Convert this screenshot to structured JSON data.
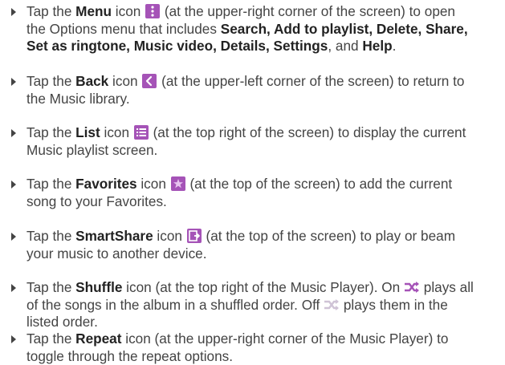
{
  "colors": {
    "accent": "#a553b7",
    "text": "#444444"
  },
  "items": [
    {
      "icon": "menu-icon",
      "l1": {
        "a": "Tap the ",
        "b": "Menu",
        "c": " icon ",
        "d": " (at the upper-right corner of the screen) to open"
      },
      "l2": {
        "a": "the Options menu that includes ",
        "b": "Search, Add to playlist, Delete, Share,"
      },
      "l3": {
        "a": "Set as ringtone, Music video, Details, Settings",
        "b": ", and ",
        "c": "Help",
        "d": "."
      }
    },
    {
      "icon": "back-icon",
      "l1": {
        "a": "Tap the ",
        "b": "Back",
        "c": " icon ",
        "d": " (at the upper-left corner of the screen) to return to"
      },
      "l2": {
        "a": "the Music library."
      }
    },
    {
      "icon": "list-icon",
      "l1": {
        "a": "Tap the ",
        "b": "List",
        "c": " icon ",
        "d": " (at the top right of the screen) to display the current"
      },
      "l2": {
        "a": "Music playlist screen."
      }
    },
    {
      "icon": "favorites-icon",
      "l1": {
        "a": "Tap the ",
        "b": "Favorites",
        "c": " icon ",
        "d": " (at the top of the screen) to add the current"
      },
      "l2": {
        "a": "song to your Favorites."
      }
    },
    {
      "icon": "smartshare-icon",
      "l1": {
        "a": "Tap the ",
        "b": "SmartShare",
        "c": " icon ",
        "d": " (at the top of the screen) to play or beam"
      },
      "l2": {
        "a": "your music to another device."
      }
    },
    {
      "icon": "shuffle-icon",
      "l1": {
        "a": "Tap the ",
        "b": "Shuffle",
        "c": " icon (at the top right of the Music Player). On ",
        "d": " plays all"
      },
      "l2": {
        "a": "of the songs in the album in a shuffled order. Off ",
        "b": " plays them in the"
      },
      "l3": {
        "a": "listed order."
      }
    },
    {
      "icon": "repeat-icon",
      "l1": {
        "a": "Tap the ",
        "b": "Repeat",
        "c": " icon (at the upper-right corner of the Music Player) to"
      },
      "l2": {
        "a": "toggle through the repeat options."
      }
    }
  ]
}
